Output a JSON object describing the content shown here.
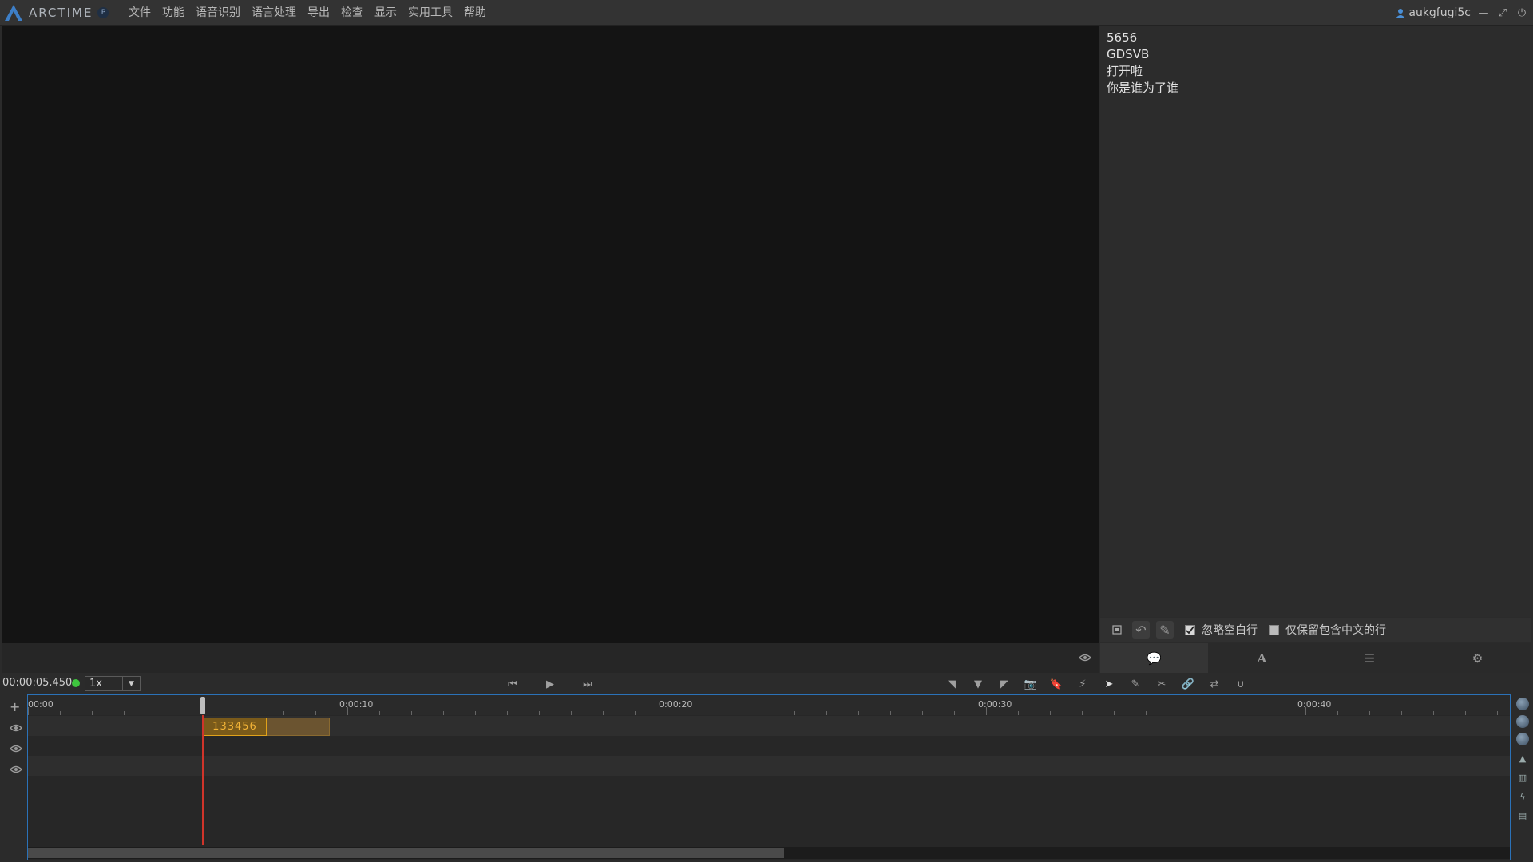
{
  "app": {
    "logo_text": "ARCTIME",
    "logo_badge": "P"
  },
  "menu": {
    "items": [
      "文件",
      "功能",
      "语音识别",
      "语言处理",
      "导出",
      "检查",
      "显示",
      "实用工具",
      "帮助"
    ]
  },
  "user": {
    "name": "aukgfugi5c"
  },
  "text_panel": {
    "lines": [
      "5656",
      "GDSVB",
      "打开啦",
      "你是谁为了谁"
    ],
    "options": {
      "ignore_blank_label": "忽略空白行",
      "ignore_blank_checked": true,
      "chinese_only_label": "仅保留包含中文的行",
      "chinese_only_checked": false
    },
    "tabs": [
      "comment-icon",
      "font-icon",
      "list-icon",
      "gear-icon"
    ]
  },
  "transport": {
    "timecode": "00:00:05.450",
    "speed": "1x"
  },
  "timeline": {
    "ruler_labels": [
      "00:00",
      "0:00:10",
      "0:00:20",
      "0:00:30",
      "0:00:40"
    ],
    "clip_label": "133456",
    "scroll_fraction": 0.51
  },
  "colors": {
    "accent_blue": "#2b72b8",
    "clip_border": "#e0a21a",
    "playhead": "#d0342a",
    "status_dot": "#3ec43e"
  }
}
